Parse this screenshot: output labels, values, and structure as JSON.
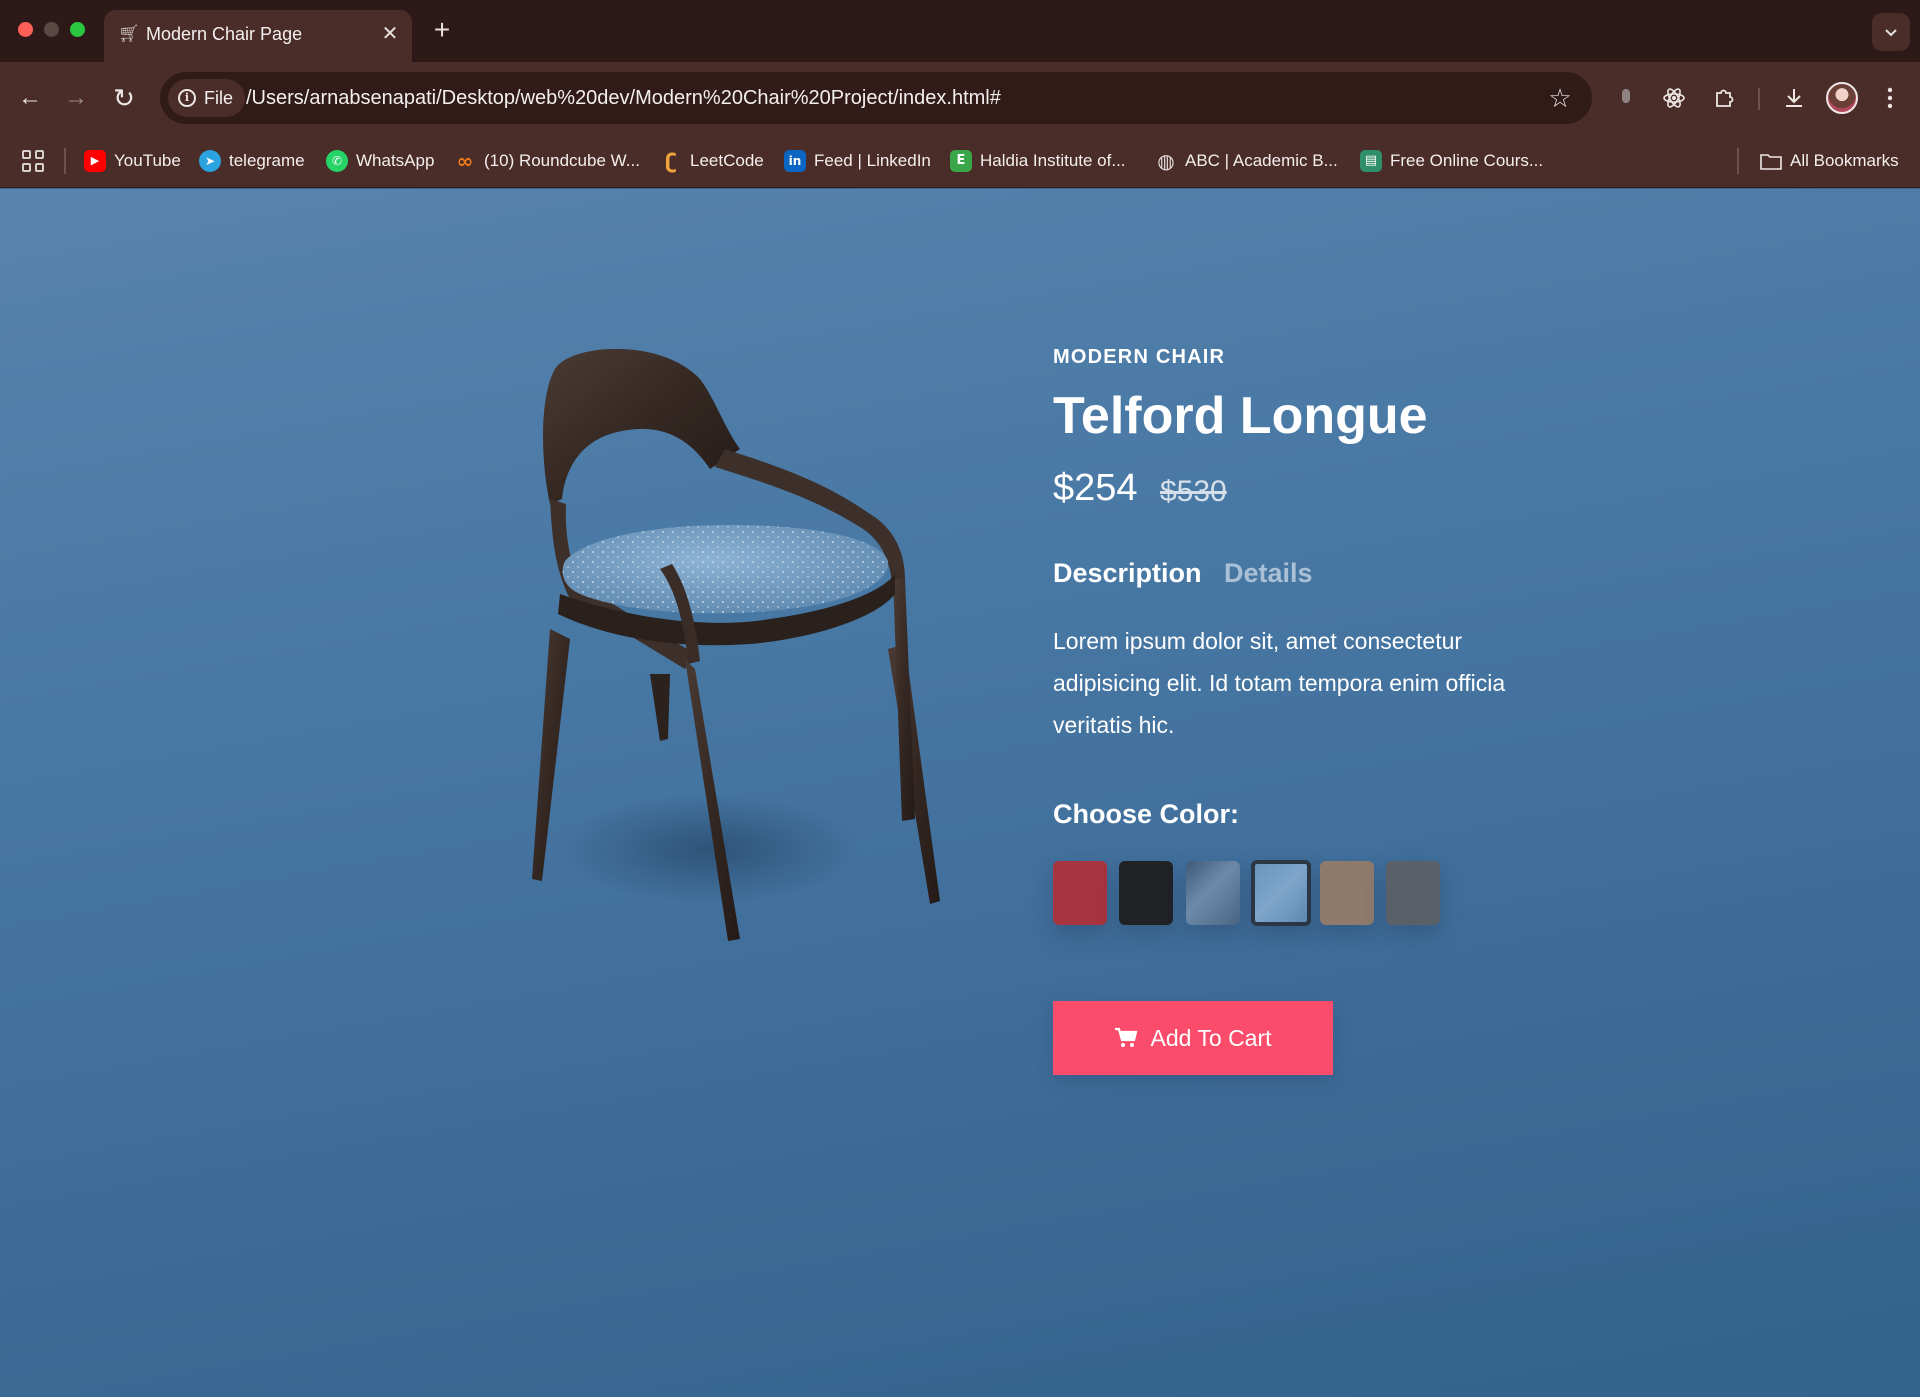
{
  "browser": {
    "tab": {
      "title": "Modern Chair Page",
      "favicon": "cart-icon",
      "close_glyph": "✕"
    },
    "new_tab_glyph": "+",
    "tab_search_glyph": "⌄",
    "toolbar": {
      "back_glyph": "←",
      "forward_glyph": "→",
      "reload_glyph": "↻",
      "site_chip": "File",
      "url": "/Users/arnabsenapati/Desktop/web%20dev/Modern%20Chair%20Project/index.html#",
      "star_glyph": "☆"
    },
    "bookmarks": [
      {
        "label": "YouTube",
        "icon": "youtube-icon",
        "color": "#ff0000",
        "glyph": "▶"
      },
      {
        "label": "telegrame",
        "icon": "telegram-icon",
        "color": "#2aa3e0",
        "glyph": "➤"
      },
      {
        "label": "WhatsApp",
        "icon": "whatsapp-icon",
        "color": "#25d366",
        "glyph": "✆"
      },
      {
        "label": "(10) Roundcube W...",
        "icon": "roundcube-icon",
        "color": "#f07b1c",
        "glyph": "∞"
      },
      {
        "label": "LeetCode",
        "icon": "leetcode-icon",
        "color": "#f0a43a",
        "glyph": "ʗ"
      },
      {
        "label": "Feed | LinkedIn",
        "icon": "linkedin-icon",
        "color": "#0a66c2",
        "glyph": "in"
      },
      {
        "label": "Haldia Institute of...",
        "icon": "haldia-icon",
        "color": "#3aa64a",
        "glyph": "E"
      },
      {
        "label": "ABC | Academic B...",
        "icon": "globe-icon",
        "color": "#6f6f6f",
        "glyph": "◍"
      },
      {
        "label": "Free Online Cours...",
        "icon": "course-icon",
        "color": "#2f8f6a",
        "glyph": "▤"
      }
    ],
    "all_bookmarks": "All Bookmarks"
  },
  "product": {
    "kicker": "MODERN CHAIR",
    "title": "Telford Longue",
    "price": "$254",
    "old_price": "$530",
    "tabs": {
      "description": "Description",
      "details": "Details"
    },
    "description": "Lorem ipsum dolor sit, amet consectetur adipisicing elit. Id totam tempora enim officia veritatis hic.",
    "color_label": "Choose Color:",
    "swatches": [
      {
        "name": "red",
        "color": "#a8343f",
        "selected": false
      },
      {
        "name": "black",
        "color": "#202226",
        "selected": false
      },
      {
        "name": "denim",
        "color": "#54718f",
        "selected": false
      },
      {
        "name": "light-blue",
        "color": "#6e98c0",
        "selected": true
      },
      {
        "name": "tan",
        "color": "#8f7a6c",
        "selected": false
      },
      {
        "name": "grey",
        "color": "#596067",
        "selected": false
      }
    ],
    "cart_button": "Add To Cart",
    "colors": {
      "accent": "#fb4d6b",
      "background": "#4878a4"
    }
  }
}
